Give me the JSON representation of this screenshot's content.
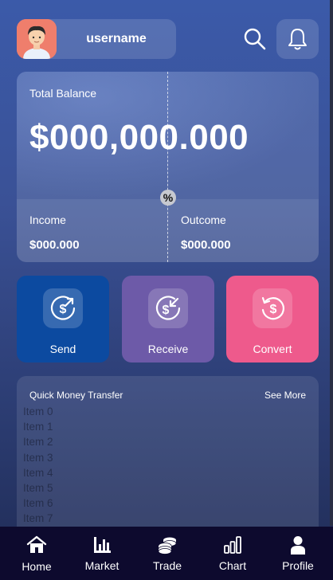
{
  "header": {
    "username": "username",
    "avatar": "user-avatar",
    "search_icon": "search-icon",
    "bell_icon": "bell-icon"
  },
  "balance": {
    "label": "Total Balance",
    "amount": "$000,000.000",
    "percent_badge": "%",
    "income_label": "Income",
    "income_value": "$000.000",
    "outcome_label": "Outcome",
    "outcome_value": "$000.000"
  },
  "actions": [
    {
      "label": "Send",
      "icon": "send-money-icon",
      "color": "#0c4aa0"
    },
    {
      "label": "Receive",
      "icon": "receive-money-icon",
      "color": "#6d5aa8"
    },
    {
      "label": "Convert",
      "icon": "convert-money-icon",
      "color": "#ee5a8c"
    }
  ],
  "transfer": {
    "title": "Quick Money Transfer",
    "see_more": "See More",
    "items": [
      "Item 0",
      "Item 1",
      "Item 2",
      "Item 3",
      "Item 4",
      "Item 5",
      "Item 6",
      "Item 7"
    ]
  },
  "nav": [
    {
      "label": "Home",
      "icon": "home-icon",
      "active": true
    },
    {
      "label": "Market",
      "icon": "bar-chart-icon"
    },
    {
      "label": "Trade",
      "icon": "coins-icon"
    },
    {
      "label": "Chart",
      "icon": "chart-icon"
    },
    {
      "label": "Profile",
      "icon": "person-icon"
    }
  ]
}
